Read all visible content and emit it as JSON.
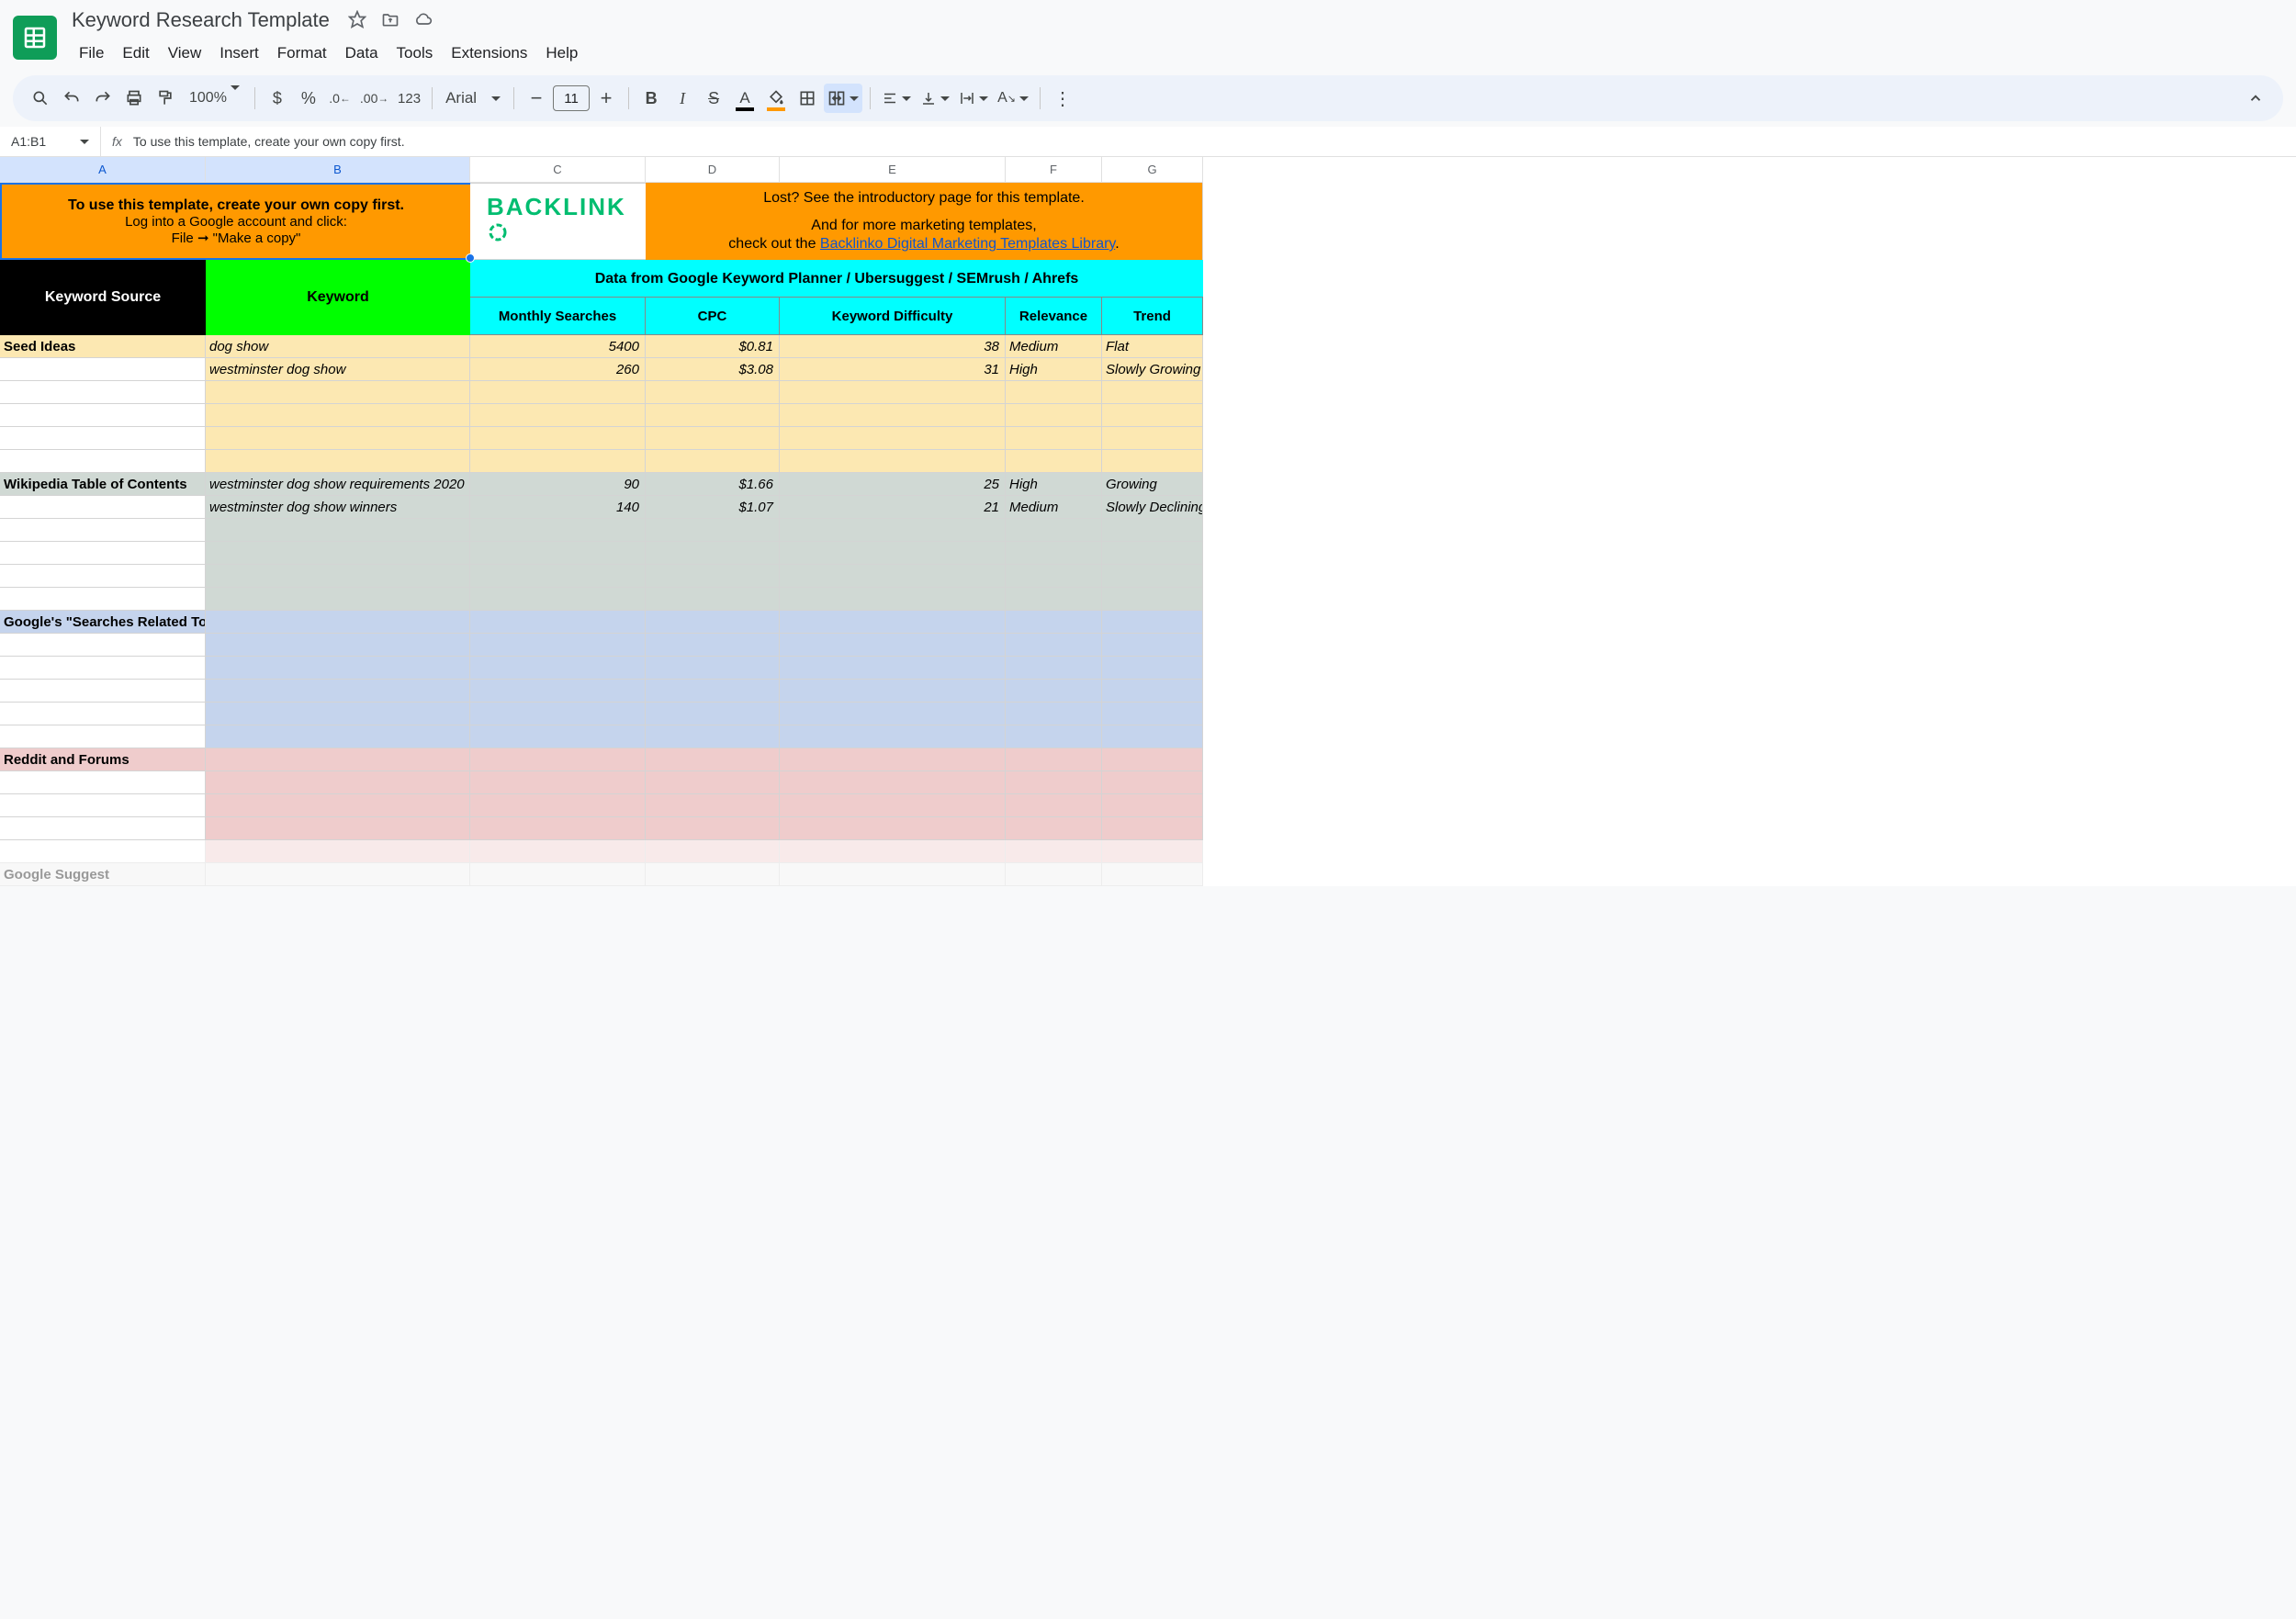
{
  "doc_title": "Keyword Research Template",
  "menus": [
    "File",
    "Edit",
    "View",
    "Insert",
    "Format",
    "Data",
    "Tools",
    "Extensions",
    "Help"
  ],
  "toolbar": {
    "zoom": "100%",
    "font": "Arial",
    "font_size": "11",
    "format_123": "123"
  },
  "formula_bar": {
    "name_box": "A1:B1",
    "formula": "To use this template, create your own copy first."
  },
  "columns": [
    "A",
    "B",
    "C",
    "D",
    "E",
    "F",
    "G"
  ],
  "banner1": {
    "line1": "To use this template, create your own copy first.",
    "line2": "Log into a Google account and click:",
    "line3": "File ➞ \"Make a copy\""
  },
  "logo_text": "BACKLINK",
  "banner2": {
    "line1": "Lost? See the introductory page for this template.",
    "line2": "And for more marketing templates,",
    "line3a": "check out the ",
    "line3_link": "Backlinko Digital Marketing Templates Library",
    "line3b": "."
  },
  "headers": {
    "source": "Keyword Source",
    "keyword": "Keyword",
    "data_group": "Data from Google Keyword Planner / Ubersuggest / SEMrush / Ahrefs",
    "monthly": "Monthly Searches",
    "cpc": "CPC",
    "difficulty": "Keyword Difficulty",
    "relevance": "Relevance",
    "trend": "Trend"
  },
  "sources": {
    "seed": "Seed Ideas",
    "wiki": "Wikipedia Table of Contents",
    "related": "Google's \"Searches Related To\"",
    "reddit": "Reddit and Forums",
    "suggest": "Google Suggest"
  },
  "rows": {
    "seed": [
      {
        "kw": "dog show",
        "monthly": "5400",
        "cpc": "$0.81",
        "diff": "38",
        "rel": "Medium",
        "trend": "Flat"
      },
      {
        "kw": "westminster dog show",
        "monthly": "260",
        "cpc": "$3.08",
        "diff": "31",
        "rel": "High",
        "trend": "Slowly Growing"
      }
    ],
    "wiki": [
      {
        "kw": "westminster dog show requirements 2020",
        "monthly": "90",
        "cpc": "$1.66",
        "diff": "25",
        "rel": "High",
        "trend": "Growing"
      },
      {
        "kw": "westminster dog show winners",
        "monthly": "140",
        "cpc": "$1.07",
        "diff": "21",
        "rel": "Medium",
        "trend": "Slowly Declining"
      }
    ]
  }
}
